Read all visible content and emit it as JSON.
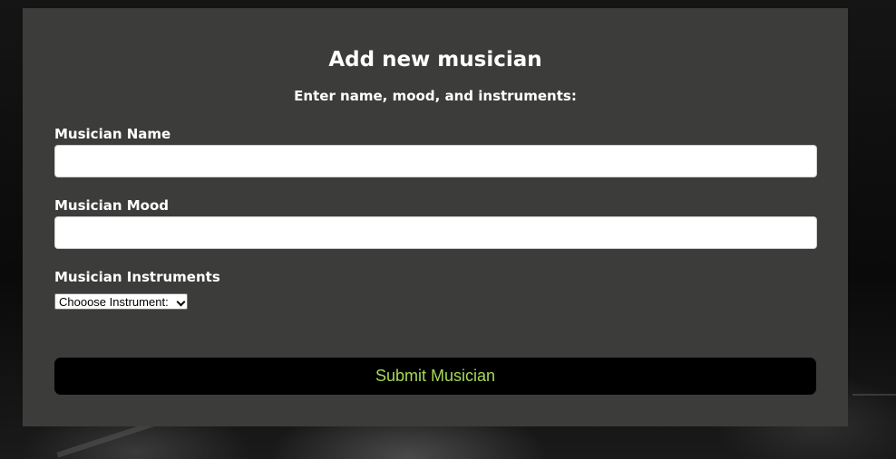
{
  "form": {
    "title": "Add new musician",
    "subtitle": "Enter name, mood, and instruments:",
    "name_label": "Musician Name",
    "name_value": "",
    "mood_label": "Musician Mood",
    "mood_value": "",
    "instruments_label": "Musician Instruments",
    "instrument_select": "Chooose Instrument:",
    "submit_label": "Submit Musician"
  },
  "colors": {
    "card_background": "#3c3d3b",
    "submit_background": "#000000",
    "submit_text": "#a6d85a"
  }
}
